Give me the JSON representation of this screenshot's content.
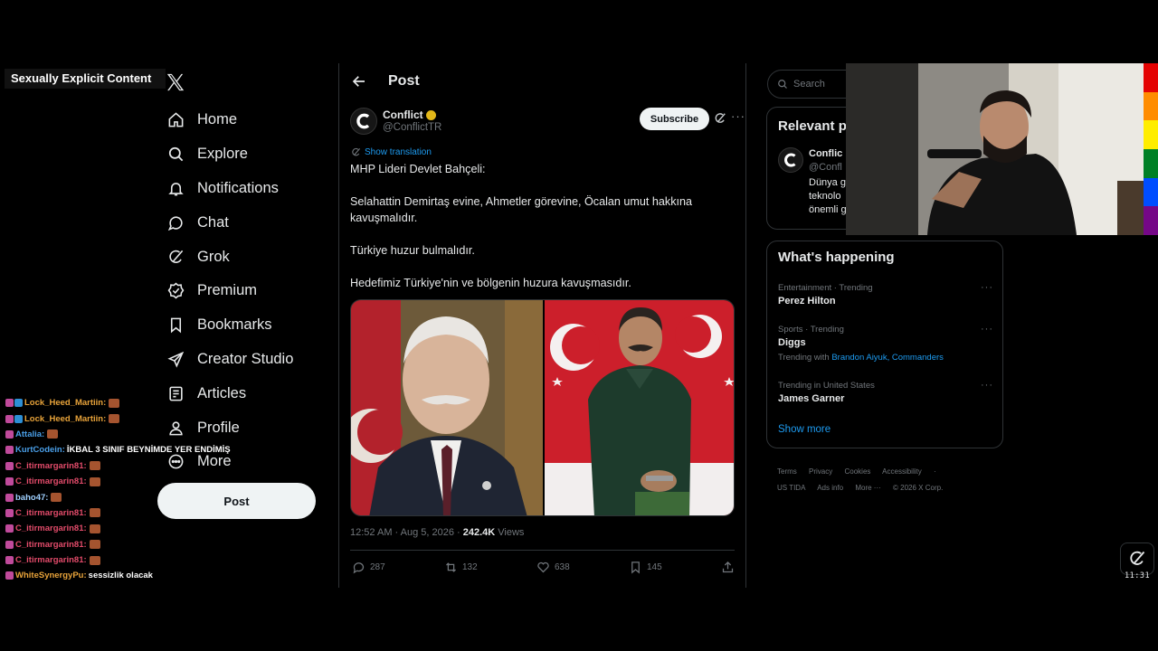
{
  "overlay": {
    "label": "Sexually Explicit Content"
  },
  "nav": {
    "items": [
      {
        "label": "Home",
        "icon": "home-icon"
      },
      {
        "label": "Explore",
        "icon": "search-icon"
      },
      {
        "label": "Notifications",
        "icon": "bell-icon"
      },
      {
        "label": "Chat",
        "icon": "chat-bubble-icon"
      },
      {
        "label": "Grok",
        "icon": "grok-icon"
      },
      {
        "label": "Premium",
        "icon": "premium-badge-icon"
      },
      {
        "label": "Bookmarks",
        "icon": "bookmark-icon"
      },
      {
        "label": "Creator Studio",
        "icon": "rocket-icon"
      },
      {
        "label": "Articles",
        "icon": "article-icon"
      },
      {
        "label": "Profile",
        "icon": "person-icon"
      },
      {
        "label": "More",
        "icon": "more-circle-icon"
      }
    ],
    "post_button": "Post"
  },
  "chat": [
    {
      "user": "Lock_Heed_Martiin:",
      "color": "#e8a33a",
      "message": ""
    },
    {
      "user": "Lock_Heed_Martiin:",
      "color": "#e8a33a",
      "message": ""
    },
    {
      "user": "Attalia:",
      "color": "#4a9fe8",
      "message": ""
    },
    {
      "user": "KurtCodein:",
      "color": "#4a9fe8",
      "message": "İKBAL 3 SINIF BEYNİMDE YER ENDİMİŞ"
    },
    {
      "user": "C_itirmargarin81:",
      "color": "#e24b6a",
      "message": ""
    },
    {
      "user": "C_itirmargarin81:",
      "color": "#e24b6a",
      "message": ""
    },
    {
      "user": "baho47:",
      "color": "#9fd0ff",
      "message": ""
    },
    {
      "user": "C_itirmargarin81:",
      "color": "#e24b6a",
      "message": ""
    },
    {
      "user": "C_itirmargarin81:",
      "color": "#e24b6a",
      "message": ""
    },
    {
      "user": "C_itirmargarin81:",
      "color": "#e24b6a",
      "message": ""
    },
    {
      "user": "C_itirmargarin81:",
      "color": "#e24b6a",
      "message": ""
    },
    {
      "user": "WhiteSynergyPu:",
      "color": "#e8a33a",
      "message": "sessizlik olacak"
    }
  ],
  "post": {
    "header_title": "Post",
    "author_name": "Conflict",
    "author_handle": "@ConflictTR",
    "subscribe_label": "Subscribe",
    "show_translation": "Show translation",
    "paragraphs": [
      "MHP Lideri Devlet Bahçeli:",
      "Selahattin Demirtaş evine, Ahmetler görevine, Öcalan umut hakkına kavuşmalıdır.",
      "Türkiye huzur bulmalıdır.",
      "Hedefimiz Türkiye'nin ve bölgenin huzura kavuşmasıdır."
    ],
    "timestamp": "12:52 AM · Aug 5, 2026 · ",
    "views_count": "242.4K",
    "views_label": " Views",
    "replies": "287",
    "reposts": "132",
    "likes": "638",
    "bookmarks": "145"
  },
  "right": {
    "search_placeholder": "Search",
    "relevant_title": "Relevant p",
    "relevant_user": "Conflic",
    "relevant_handle": "@Confl",
    "relevant_text_1": "Dünya g",
    "relevant_text_2": "teknolo",
    "relevant_text_3": "önemli g",
    "happening_title": "What's happening",
    "trends": [
      {
        "context": "Entertainment · Trending",
        "name": "Perez Hilton",
        "with_label": "",
        "with_links": ""
      },
      {
        "context": "Sports · Trending",
        "name": "Diggs",
        "with_label": "Trending with ",
        "with_links": "Brandon Aiyuk, Commanders"
      },
      {
        "context": "Trending in United States",
        "name": "James Garner",
        "with_label": "",
        "with_links": ""
      }
    ],
    "show_more": "Show more",
    "footer_line1": [
      "Terms",
      "Privacy",
      "Cookies",
      "Accessibility",
      "·"
    ],
    "footer_line2": [
      "US TIDA",
      "Ads info",
      "More ···",
      "© 2026 X Corp."
    ]
  },
  "clock": "11:31",
  "colors": {
    "accent": "#1d9bf0",
    "background": "#000000",
    "border": "#2f3336"
  }
}
